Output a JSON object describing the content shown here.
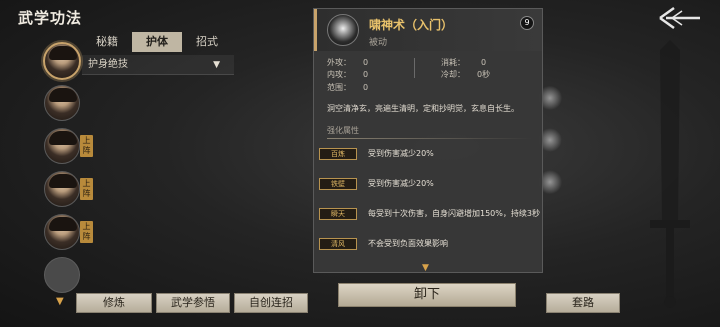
{
  "header": {
    "title": "武学功法"
  },
  "tabs": [
    {
      "label": "秘籍",
      "active": false
    },
    {
      "label": "护体",
      "active": true
    },
    {
      "label": "招式",
      "active": false
    }
  ],
  "dropdown": {
    "value": "护身绝技"
  },
  "roster": {
    "on_badge": "上阵",
    "more_icon": "chevron-down"
  },
  "skill": {
    "name": "啸神术（入门）",
    "type": "被动",
    "level": "9",
    "stats": {
      "outer_attack_label": "外攻：",
      "outer_attack": "0",
      "inner_attack_label": "内攻：",
      "inner_attack": "0",
      "range_label": "范围：",
      "range": "0",
      "consume_label": "消耗：",
      "consume": "0",
      "cooldown_label": "冷却：",
      "cooldown": "0秒"
    },
    "description": "洞空清净玄，亮遍生清明，定和抄明觉，玄息自长生。",
    "section_title": "强化属性",
    "effects": [
      {
        "tag": "百炼",
        "text": "受到伤害减少20%"
      },
      {
        "tag": "铁壁",
        "text": "受到伤害减少20%"
      },
      {
        "tag": "瞬天",
        "text": "每受到十次伤害，自身闪避增加150%，持续3秒"
      },
      {
        "tag": "清风",
        "text": "不会受到负面效果影响"
      }
    ]
  },
  "buttons": {
    "train": "修炼",
    "study": "武学参悟",
    "create": "自创连招",
    "unequip": "卸下",
    "routine": "套路"
  },
  "colors": {
    "accent_gold": "#c8a36b",
    "name_gold": "#e8c16b",
    "tag_gold": "#e0b865"
  }
}
